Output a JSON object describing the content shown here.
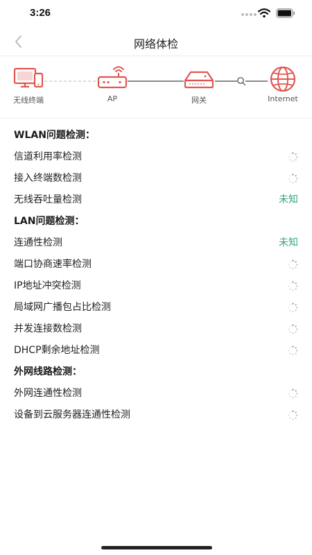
{
  "status_bar": {
    "time": "3:26",
    "icons": [
      "signal-dots-icon",
      "wifi-icon",
      "battery-icon"
    ]
  },
  "nav": {
    "title": "网络体检",
    "back_icon": "chevron-left-icon"
  },
  "topology": {
    "nodes": [
      {
        "label": "无线终端",
        "icon": "terminal-devices-icon"
      },
      {
        "label": "AP",
        "icon": "access-point-icon"
      },
      {
        "label": "网关",
        "icon": "gateway-icon"
      },
      {
        "label": "Internet",
        "icon": "globe-icon"
      }
    ],
    "accent_color": "#e0564f"
  },
  "sections": [
    {
      "title": "WLAN问题检测：",
      "items": [
        {
          "label": "信道利用率检测",
          "status": "",
          "status_icon": "loading-spinner-icon"
        },
        {
          "label": "接入终端数检测",
          "status": "",
          "status_icon": "loading-spinner-icon"
        },
        {
          "label": "无线吞吐量检测",
          "status": "未知",
          "status_icon": ""
        }
      ]
    },
    {
      "title": "LAN问题检测：",
      "items": [
        {
          "label": "连通性检测",
          "status": "未知",
          "status_icon": ""
        },
        {
          "label": "端口协商速率检测",
          "status": "",
          "status_icon": "loading-spinner-icon"
        },
        {
          "label": "IP地址冲突检测",
          "status": "",
          "status_icon": "loading-spinner-icon"
        },
        {
          "label": "局域网广播包占比检测",
          "status": "",
          "status_icon": "loading-spinner-icon"
        },
        {
          "label": "并发连接数检测",
          "status": "",
          "status_icon": "loading-spinner-icon"
        },
        {
          "label": "DHCP剩余地址检测",
          "status": "",
          "status_icon": "loading-spinner-icon"
        }
      ]
    },
    {
      "title": "外网线路检测：",
      "items": [
        {
          "label": "外网连通性检测",
          "status": "",
          "status_icon": "loading-spinner-icon"
        },
        {
          "label": "设备到云服务器连通性检测",
          "status": "",
          "status_icon": "loading-spinner-icon"
        }
      ]
    }
  ],
  "colors": {
    "status_unknown": "#3aa57a",
    "accent": "#e0564f"
  }
}
